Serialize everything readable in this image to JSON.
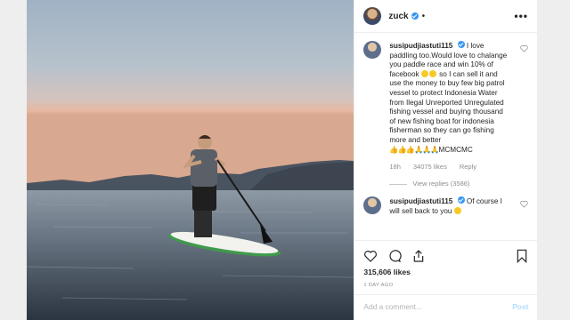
{
  "post": {
    "username": "zuck",
    "separator": "•",
    "more_label": "•••",
    "comments": [
      {
        "username": "susipudjiastuti115",
        "text_1": "I love paddling too.Would love to chalange you paddle race and win 10% of facebook",
        "text_2": "so I can sell it and use the money to buy few big patrol vessel to protect Indonesia Water from Ilegal Unreported Unregulated fishing vessel and buying thousand of new fishing boat for indonesia fisherman so they can go fishing more and better",
        "hands": "👍👍👍🙏🙏🙏",
        "text_3": "MCMCMC",
        "age": "18h",
        "likes": "34075 likes",
        "reply": "Reply",
        "view_replies": "View replies (3586)"
      },
      {
        "username": "susipudjiastuti115",
        "text_1": "Of course I will sell back to you",
        "text_2": ""
      }
    ],
    "likes_count": "315,606 likes",
    "timestamp": "1 DAY AGO",
    "comment_placeholder": "Add a comment...",
    "post_button": "Post"
  },
  "colors": {
    "verified": "#3897f0",
    "post_button": "#b3dbff"
  },
  "icons": [
    "verified-badge-icon",
    "more-options-icon",
    "heart-icon",
    "comment-icon",
    "share-icon",
    "bookmark-icon"
  ]
}
